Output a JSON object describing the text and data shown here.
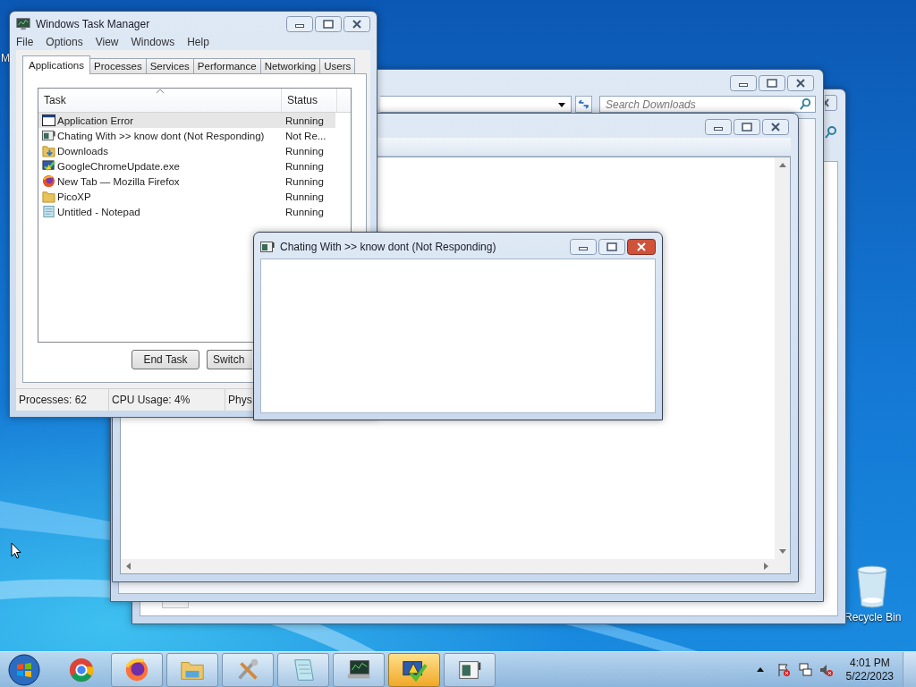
{
  "desktop_icons": [
    {
      "kind": "cut",
      "label": "M"
    },
    {
      "kind": "recycle_bin",
      "label": "Recycle Bin"
    }
  ],
  "explorer": {
    "search": {
      "placeholder": "Search Downloads"
    }
  },
  "task_manager": {
    "title": "Windows Task Manager",
    "menu": [
      "File",
      "Options",
      "View",
      "Windows",
      "Help"
    ],
    "tabs": [
      {
        "label": "Applications",
        "selected": true
      },
      {
        "label": "Processes",
        "selected": false
      },
      {
        "label": "Services",
        "selected": false
      },
      {
        "label": "Performance",
        "selected": false
      },
      {
        "label": "Networking",
        "selected": false
      },
      {
        "label": "Users",
        "selected": false
      }
    ],
    "columns": [
      "Task",
      "Status"
    ],
    "rows": [
      {
        "kind": "window",
        "task": "Application Error",
        "status": "Running",
        "selected": true
      },
      {
        "kind": "app",
        "task": "Chating With >> know dont (Not Responding)",
        "status": "Not Re...",
        "selected": false
      },
      {
        "kind": "folder_download",
        "task": "Downloads",
        "status": "Running",
        "selected": false
      },
      {
        "kind": "update",
        "task": "GoogleChromeUpdate.exe",
        "status": "Running",
        "selected": false
      },
      {
        "kind": "firefox",
        "task": "New Tab — Mozilla Firefox",
        "status": "Running",
        "selected": false
      },
      {
        "kind": "folder",
        "task": "PicoXP",
        "status": "Running",
        "selected": false
      },
      {
        "kind": "notepad",
        "task": "Untitled - Notepad",
        "status": "Running",
        "selected": false
      }
    ],
    "buttons": [
      "End Task",
      "Switch"
    ],
    "status_bar": [
      "Processes: 62",
      "CPU Usage: 4%",
      "Phys"
    ]
  },
  "chat_window": {
    "title": "Chating With >> know dont (Not Responding)"
  },
  "taskbar": {
    "items": [
      {
        "kind": "chrome",
        "running": false,
        "selected": false
      },
      {
        "kind": "firefox",
        "running": true,
        "selected": false
      },
      {
        "kind": "explorer",
        "running": true,
        "selected": false
      },
      {
        "kind": "tools",
        "running": true,
        "selected": false
      },
      {
        "kind": "notepad",
        "running": true,
        "selected": false
      },
      {
        "kind": "taskmgr",
        "running": true,
        "selected": false
      },
      {
        "kind": "warning",
        "running": true,
        "selected": true
      },
      {
        "kind": "app",
        "running": true,
        "selected": false
      }
    ],
    "time": "4:01 PM",
    "date": "5/22/2023"
  }
}
